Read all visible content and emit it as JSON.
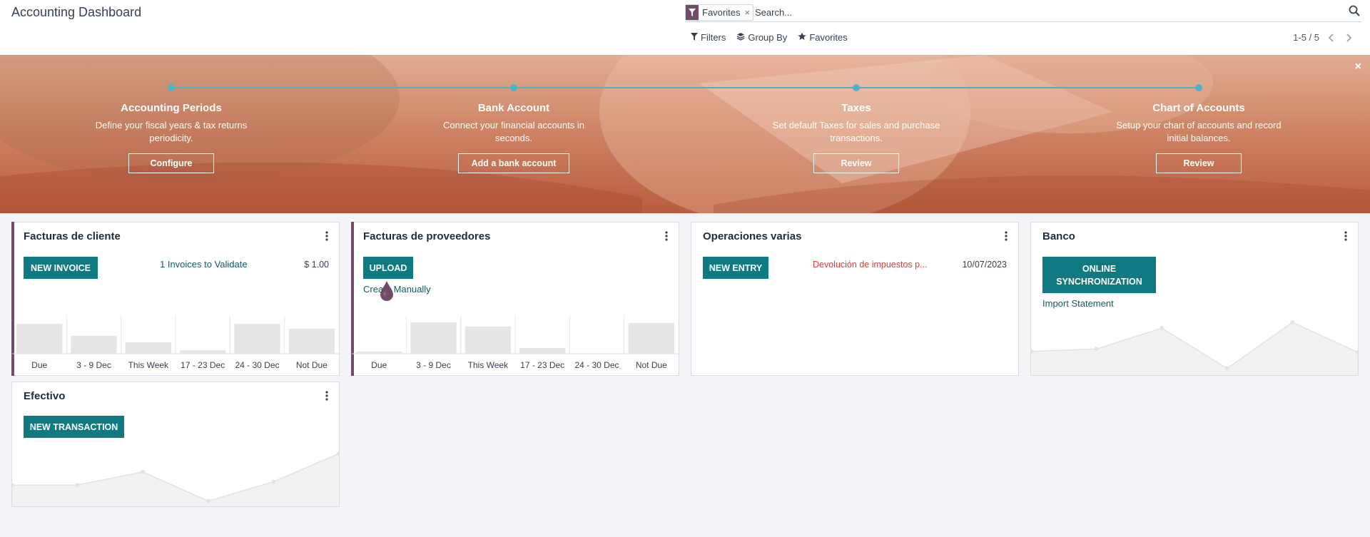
{
  "header": {
    "title": "Accounting Dashboard",
    "search": {
      "facet_label": "Favorites",
      "facet_remove": "×",
      "placeholder": "Search..."
    },
    "buttons": {
      "filters": "Filters",
      "group_by": "Group By",
      "favorites": "Favorites"
    },
    "pager": "1-5 / 5"
  },
  "banner": {
    "close": "×",
    "steps": [
      {
        "title": "Accounting Periods",
        "description": "Define your fiscal years & tax returns periodicity.",
        "button": "Configure"
      },
      {
        "title": "Bank Account",
        "description": "Connect your financial accounts in seconds.",
        "button": "Add a bank account"
      },
      {
        "title": "Taxes",
        "description": "Set default Taxes for sales and purchase transactions.",
        "button": "Review"
      },
      {
        "title": "Chart of Accounts",
        "description": "Setup your chart of accounts and record initial balances.",
        "button": "Review"
      }
    ]
  },
  "journals": {
    "customer_invoices": {
      "title": "Facturas de cliente",
      "button": "NEW INVOICE",
      "to_validate": "1 Invoices to Validate",
      "amount": "$ 1.00",
      "graph": {
        "categories": [
          "Due",
          "3 - 9 Dec",
          "This Week",
          "17 - 23 Dec",
          "24 - 30 Dec",
          "Not Due"
        ],
        "values": [
          0.8,
          0.48,
          0.3,
          0.1,
          0.8,
          0.68
        ]
      }
    },
    "vendor_bills": {
      "title": "Facturas de proveedores",
      "button": "UPLOAD",
      "create_manually": "Create Manually",
      "graph": {
        "categories": [
          "Due",
          "3 - 9 Dec",
          "This Week",
          "17 - 23 Dec",
          "24 - 30 Dec",
          "Not Due"
        ],
        "values": [
          0.06,
          0.84,
          0.74,
          0.16,
          0,
          0.82
        ]
      }
    },
    "misc": {
      "title": "Operaciones varias",
      "button": "NEW ENTRY",
      "entry_label": "Devolución de impuestos p...",
      "entry_date": "10/07/2023"
    },
    "bank": {
      "title": "Banco",
      "button": "ONLINE SYNCHRONIZATION",
      "import_link": "Import Statement",
      "graph": {
        "values": [
          0.4,
          0.45,
          0.88,
          0.05,
          1.0,
          0.38
        ]
      }
    },
    "cash": {
      "title": "Efectivo",
      "button": "NEW TRANSACTION",
      "graph": {
        "values": [
          0.35,
          0.35,
          0.62,
          0.02,
          0.42,
          1.0
        ]
      }
    }
  },
  "colors": {
    "brand": "#714b67",
    "primary_button": "#0f7a81",
    "banner_step": "#4fb1c9",
    "warning_text": "#d23f3a"
  }
}
